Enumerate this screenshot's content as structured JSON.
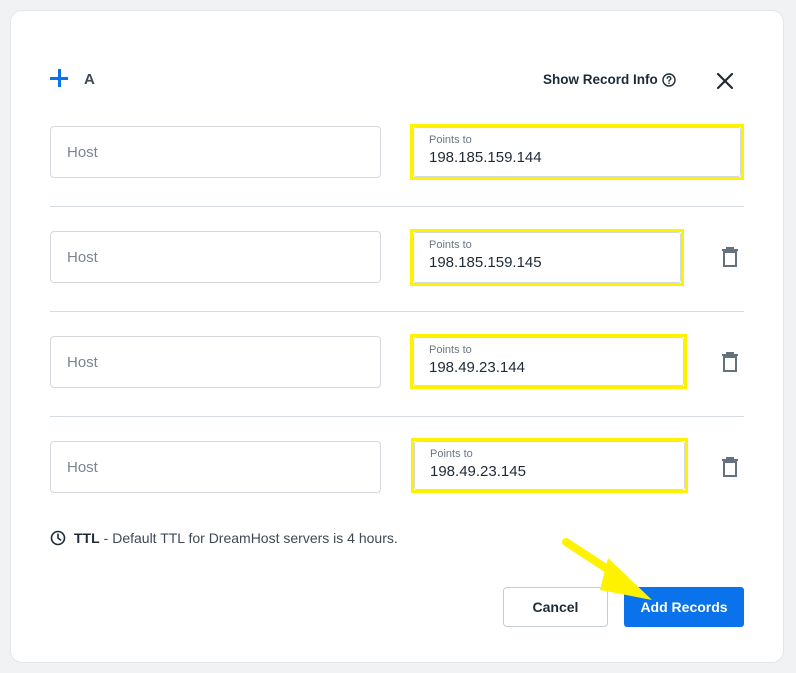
{
  "header": {
    "record_type": "A",
    "show_record_info_label": "Show Record Info",
    "icons": {
      "add": "plus-icon",
      "help": "question-circle-icon",
      "close": "close-icon"
    }
  },
  "records": [
    {
      "host_placeholder": "Host",
      "host_value": "",
      "points_to_label": "Points to",
      "points_to_value": "198.185.159.144",
      "deletable": false
    },
    {
      "host_placeholder": "Host",
      "host_value": "",
      "points_to_label": "Points to",
      "points_to_value": "198.185.159.145",
      "deletable": true
    },
    {
      "host_placeholder": "Host",
      "host_value": "",
      "points_to_label": "Points to",
      "points_to_value": "198.49.23.144",
      "deletable": true
    },
    {
      "host_placeholder": "Host",
      "host_value": "",
      "points_to_label": "Points to",
      "points_to_value": "198.49.23.145",
      "deletable": true
    }
  ],
  "ttl": {
    "label": "TTL",
    "text": "- Default TTL for DreamHost servers is 4 hours.",
    "icon": "clock-icon"
  },
  "footer": {
    "cancel_label": "Cancel",
    "add_label": "Add Records"
  },
  "colors": {
    "accent": "#0a73eb",
    "highlight": "#fff200"
  }
}
